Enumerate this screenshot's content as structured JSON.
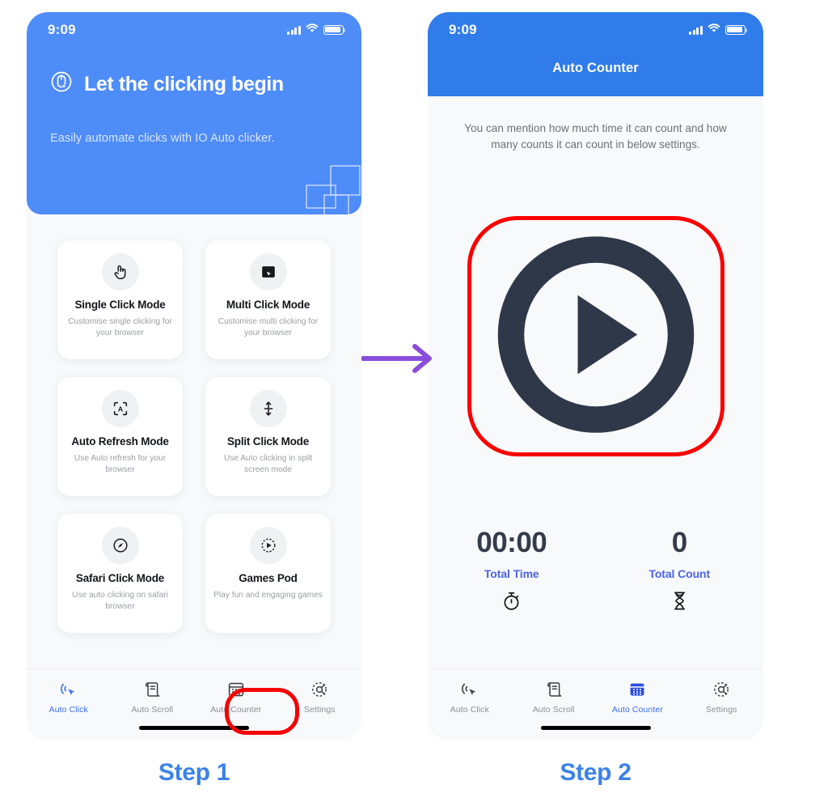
{
  "accent": {
    "hero_blue": "#4e8cf7",
    "nav_blue": "#2f7cea",
    "step_blue": "#3b82e8",
    "stat_blue": "#4a63e8",
    "highlight_red": "#f50505",
    "arrow_purple": "#8a4ddb",
    "dark": "#343b4a"
  },
  "steps": [
    {
      "caption": "Step 1"
    },
    {
      "caption": "Step 2"
    }
  ],
  "arrow": {
    "icon": "arrow-right-icon"
  },
  "phone1": {
    "status": {
      "time": "9:09",
      "signal_icon": "cellular-signal-icon",
      "wifi_icon": "wifi-icon",
      "battery_icon": "battery-full-icon"
    },
    "hero": {
      "icon": "mouse-click-icon",
      "title": "Let the clicking begin",
      "subtitle": "Easily automate clicks with IO Auto clicker.",
      "decoration_icon": "overlapping-squares-decoration"
    },
    "cards": [
      {
        "icon": "hand-tap-icon",
        "title": "Single Click Mode",
        "desc": "Customise single clicking for your browser"
      },
      {
        "icon": "multi-click-icon",
        "title": "Multi Click Mode",
        "desc": "Customise multi clicking for your browser"
      },
      {
        "icon": "auto-refresh-icon",
        "title": "Auto Refresh Mode",
        "desc": "Use Auto refresh for your browser"
      },
      {
        "icon": "split-arrows-icon",
        "title": "Split Click Mode",
        "desc": "Use Auto clicking in spilt screen mode"
      },
      {
        "icon": "safari-compass-icon",
        "title": "Safari Click Mode",
        "desc": "Use auto clicking on safari browser"
      },
      {
        "icon": "games-pod-icon",
        "title": "Games Pod",
        "desc": "Play fun and engaging games"
      }
    ],
    "tabs": [
      {
        "icon": "auto-click-icon",
        "label": "Auto Click",
        "active": true,
        "highlighted": false
      },
      {
        "icon": "auto-scroll-icon",
        "label": "Auto Scroll",
        "active": false,
        "highlighted": false
      },
      {
        "icon": "auto-counter-icon",
        "label": "Auto Counter",
        "active": false,
        "highlighted": true
      },
      {
        "icon": "settings-gear-icon",
        "label": "Settings",
        "active": false,
        "highlighted": false
      }
    ]
  },
  "phone2": {
    "status": {
      "time": "9:09",
      "signal_icon": "cellular-signal-icon",
      "wifi_icon": "wifi-icon",
      "battery_icon": "battery-full-icon"
    },
    "nav_title": "Auto Counter",
    "description": "You can mention how much time it can count and how many counts it can count in below settings.",
    "play_button": {
      "icon": "play-circle-icon",
      "highlighted": true
    },
    "stats": [
      {
        "value": "00:00",
        "label": "Total Time",
        "icon": "stopwatch-icon"
      },
      {
        "value": "0",
        "label": "Total Count",
        "icon": "hourglass-icon"
      }
    ],
    "tabs": [
      {
        "icon": "auto-click-icon",
        "label": "Auto Click",
        "active": false
      },
      {
        "icon": "auto-scroll-icon",
        "label": "Auto Scroll",
        "active": false
      },
      {
        "icon": "auto-counter-icon",
        "label": "Auto Counter",
        "active": true
      },
      {
        "icon": "settings-gear-icon",
        "label": "Settings",
        "active": false
      }
    ]
  }
}
